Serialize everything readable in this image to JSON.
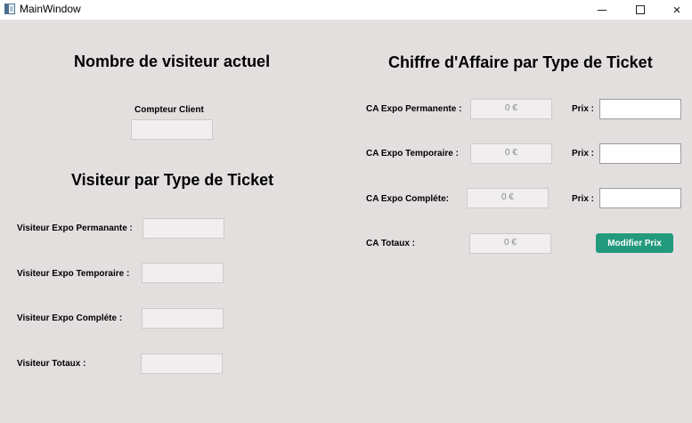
{
  "window": {
    "title": "MainWindow",
    "controls": {
      "minimize": "minimize-icon",
      "maximize": "maximize-icon",
      "close": "×"
    }
  },
  "left": {
    "visiteur_actuel_title": "Nombre de visiteur actuel",
    "compteur_label": "Compteur Client",
    "compteur_value": "",
    "visiteur_type_title": "Visiteur par Type de Ticket",
    "rows": [
      {
        "label": "Visiteur Expo Permanante :",
        "value": ""
      },
      {
        "label": "Visiteur Expo Temporaire :",
        "value": ""
      },
      {
        "label": "Visiteur Expo Compléte :",
        "value": ""
      },
      {
        "label": "Visiteur Totaux :",
        "value": ""
      }
    ]
  },
  "right": {
    "title": "Chiffre d'Affaire par Type de Ticket",
    "rows": [
      {
        "label": "CA Expo Permanente :",
        "value": "0 €",
        "prix_label": "Prix :",
        "prix_value": ""
      },
      {
        "label": "CA Expo Temporaire :",
        "value": "0 €",
        "prix_label": "Prix :",
        "prix_value": ""
      },
      {
        "label": "CA Expo Compléte:",
        "value": "0 €",
        "prix_label": "Prix :",
        "prix_value": ""
      }
    ],
    "totaux_label": "CA Totaux :",
    "totaux_value": "0 €",
    "modifier_button": "Modifier Prix"
  },
  "colors": {
    "background": "#e4dfdf",
    "button": "#239a7e"
  }
}
